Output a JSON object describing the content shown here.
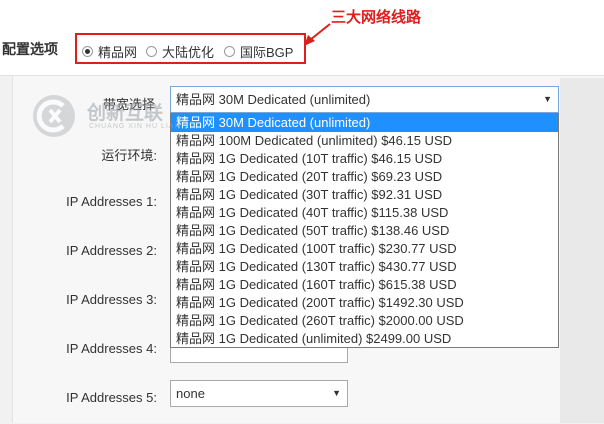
{
  "annotation": "三大网络线路",
  "config": {
    "label": "配置选项",
    "options": [
      {
        "label": "精品网",
        "checked": true
      },
      {
        "label": "大陆优化",
        "checked": false
      },
      {
        "label": "国际BGP",
        "checked": false
      }
    ]
  },
  "watermark": {
    "text": "创新互联",
    "subtext": "CHUANG XIN HU LIAN"
  },
  "form": {
    "bandwidth_label": "带宽选择",
    "bandwidth_value": "精品网 30M Dedicated (unlimited)",
    "os_label": "运行环境:",
    "ip_labels": [
      "IP Addresses 1:",
      "IP Addresses 2:",
      "IP Addresses 3:",
      "IP Addresses 4:",
      "IP Addresses 5:"
    ],
    "ip5_value": "none"
  },
  "dropdown": {
    "items": [
      "精品网 30M Dedicated (unlimited)",
      "精品网 100M Dedicated (unlimited) $46.15 USD",
      "精品网 1G Dedicated (10T traffic) $46.15 USD",
      "精品网 1G Dedicated (20T traffic) $69.23 USD",
      "精品网 1G Dedicated (30T traffic) $92.31 USD",
      "精品网 1G Dedicated (40T traffic) $115.38 USD",
      "精品网 1G Dedicated (50T traffic) $138.46 USD",
      "精品网 1G Dedicated (100T traffic) $230.77 USD",
      "精品网 1G Dedicated (130T traffic) $430.77 USD",
      "精品网 1G Dedicated (160T traffic) $615.38 USD",
      "精品网 1G Dedicated (200T traffic) $1492.30 USD",
      "精品网 1G Dedicated (260T traffic) $2000.00 USD",
      "精品网 1G Dedicated (unlimited) $2499.00 USD"
    ],
    "selected_index": 0
  },
  "colors": {
    "annotation": "#e01e1e",
    "highlight": "#1e90ff"
  }
}
